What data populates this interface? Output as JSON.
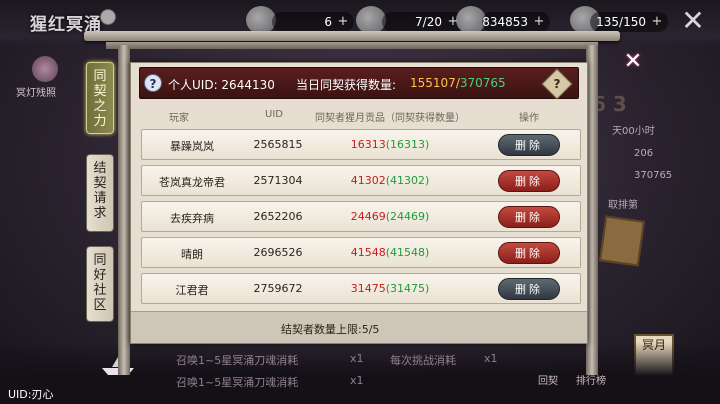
{
  "top_bar": {
    "logo": "猩红冥涌",
    "res_1": "6",
    "res_2": "7/20",
    "res_3": "834853",
    "res_4": "135/150",
    "plus": "+"
  },
  "left_menu": {
    "label": "冥灯残照"
  },
  "tabs": [
    {
      "label": "同契之力",
      "active": true
    },
    {
      "label": "结契请求",
      "active": false
    },
    {
      "label": "同好社区",
      "active": false
    }
  ],
  "panel": {
    "uid_label": "个人UID: 2644130",
    "daily_label": "当日同契获得数量:",
    "daily_current": "155107",
    "daily_sep": "/",
    "daily_max": "370765",
    "help": "?",
    "columns": {
      "player": "玩家",
      "uid": "UID",
      "amount": "同契者猩月贡品（同契获得数量）",
      "action": "操作"
    },
    "rows": [
      {
        "name": "暴躁岚岚",
        "uid": "2565815",
        "amount": "16313",
        "gained": "(16313)",
        "button": "删除",
        "button_style": "gray"
      },
      {
        "name": "苍岚真龙帝君",
        "uid": "2571304",
        "amount": "41302",
        "gained": "(41302)",
        "button": "删除",
        "button_style": "red"
      },
      {
        "name": "去疾弃病",
        "uid": "2652206",
        "amount": "24469",
        "gained": "(24469)",
        "button": "删除",
        "button_style": "red"
      },
      {
        "name": "晴朗",
        "uid": "2696526",
        "amount": "41548",
        "gained": "(41548)",
        "button": "删除",
        "button_style": "red"
      },
      {
        "name": "江君君",
        "uid": "2759672",
        "amount": "31475",
        "gained": "(31475)",
        "button": "删除",
        "button_style": "gray"
      }
    ],
    "footer": "结契者数量上限:5/5"
  },
  "background": {
    "right_lines": [
      "天00小时",
      "206",
      "370765",
      "取排第"
    ],
    "big_num": "6 3",
    "seal": "冥月",
    "btn_1": "回契",
    "btn_2": "排行榜",
    "bottom_lines": [
      "召唤1~5星冥涌刀魂消耗",
      "召唤1~5星冥涌刀魂消耗",
      "x1",
      "x1",
      "每次挑战消耗",
      "x1"
    ],
    "uid_bottom": "UID:刃心"
  },
  "colors": {
    "header_bg": "#4a1818",
    "amount_red": "#c81d1d",
    "amount_green": "#1f9b3c",
    "daily_gold": "#ffc44a",
    "daily_green": "#46d17a",
    "remove_red": "#a8332b",
    "remove_gray": "#465158"
  },
  "icons": [
    "close-icon",
    "help-icon",
    "plus-icon",
    "boat-icon",
    "lantern-icon"
  ]
}
